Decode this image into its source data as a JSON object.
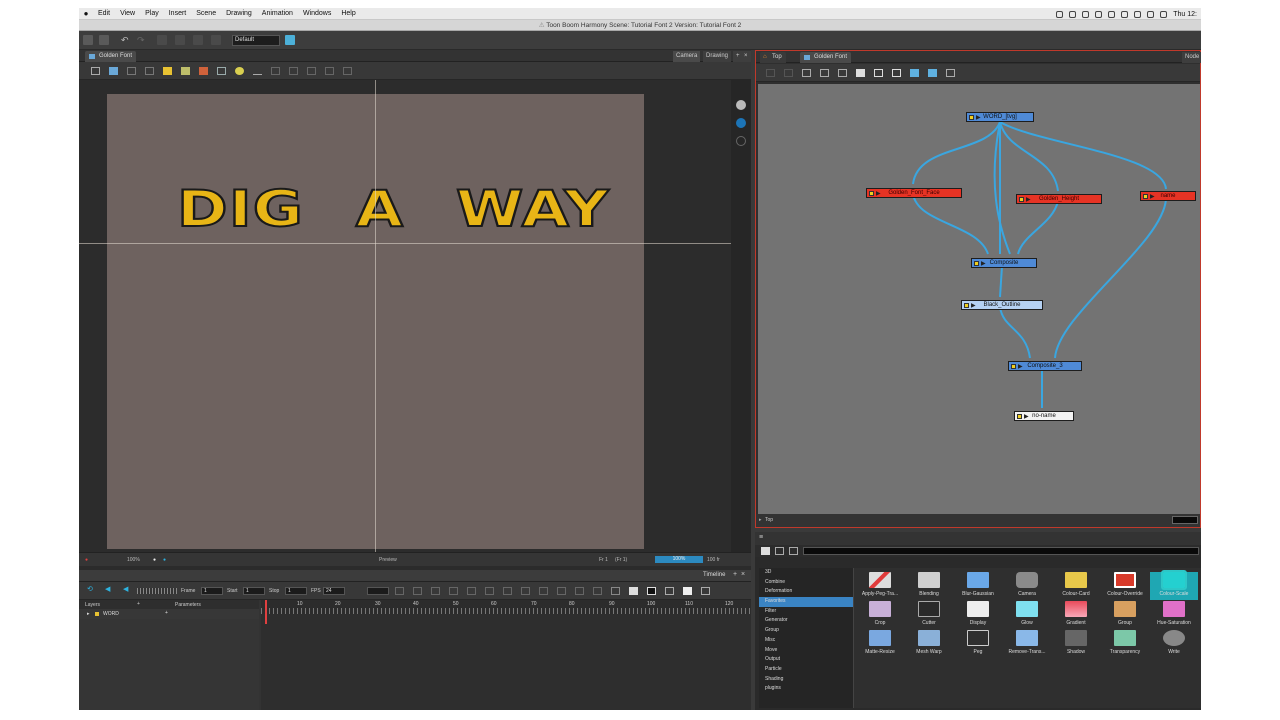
{
  "menubar": {
    "items": [
      "Edit",
      "View",
      "Play",
      "Insert",
      "Scene",
      "Drawing",
      "Animation",
      "Windows",
      "Help"
    ],
    "clock": "Thu 12:"
  },
  "window": {
    "title": "Toon Boom Harmony Scene: Tutorial Font 2 Version: Tutorial Font 2"
  },
  "toolbar": {
    "preset": "Default"
  },
  "camera": {
    "tab": "Golden Font",
    "view_tabs": [
      "Camera",
      "Drawing"
    ],
    "artwork_text": "DIG A WAY",
    "zoom": "100%",
    "preview": "Preview",
    "frame": "Fr 1",
    "frame_total": "(Fr 1)",
    "progress": "100%",
    "fps_readout": "100 fr"
  },
  "node_view": {
    "tab_breadcrumb": "Top",
    "tab": "Golden Font",
    "right_tab": "Node",
    "bottom_path": "Top",
    "nodes": [
      {
        "id": "word",
        "label": "WORD_[tvg]"
      },
      {
        "id": "golden-face",
        "label": "Golden_Font_Face"
      },
      {
        "id": "golden-height",
        "label": "Golden_Height"
      },
      {
        "id": "name",
        "label": "name"
      },
      {
        "id": "composite",
        "label": "Composite"
      },
      {
        "id": "black-outline",
        "label": "Black_Outline"
      },
      {
        "id": "composite-3",
        "label": "Composite_3"
      },
      {
        "id": "no-name",
        "label": "no-name"
      }
    ]
  },
  "library": {
    "categories": [
      "3D",
      "Combine",
      "Deformation",
      "Favorites",
      "Filter",
      "Generator",
      "Group",
      "Misc",
      "Move",
      "Output",
      "Particle",
      "Shading",
      "plugins"
    ],
    "selected_category": "Favorites",
    "effects": [
      "Apply-Peg-Tra...",
      "Blending",
      "Blur-Gaussian",
      "Camera",
      "Colour-Card",
      "Colour-Override",
      "Colour-Scale",
      "Crop",
      "Cutter",
      "Display",
      "Glow",
      "Gradient",
      "Group",
      "Hue-Saturation",
      "Matte-Resize",
      "Mesh Warp",
      "Peg",
      "Remove-Trans...",
      "Shadow",
      "Transparency",
      "Write"
    ],
    "selected_effect": "Colour-Scale"
  },
  "timeline": {
    "title": "Timeline",
    "frame_label": "Frame",
    "frame_value": "1",
    "start_label": "Start",
    "start_value": "1",
    "stop_label": "Stop",
    "stop_value": "1",
    "fps_label": "FPS",
    "fps_value": "24",
    "layers_label": "Layers",
    "parameters_label": "Parameters",
    "layer_name": "WORD",
    "ruler_ticks": [
      "10",
      "20",
      "30",
      "40",
      "50",
      "60",
      "70",
      "80",
      "90",
      "100",
      "110",
      "120"
    ]
  },
  "colors": {
    "node_blue": "#4f8ad6",
    "node_red": "#e63324",
    "wire": "#3aa6e0",
    "text_fill": "#e8b516",
    "selection": "#3a84c4"
  }
}
